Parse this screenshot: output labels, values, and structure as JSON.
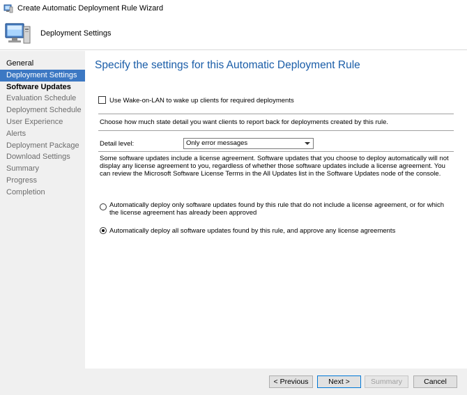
{
  "window": {
    "title": "Create Automatic Deployment Rule Wizard"
  },
  "header": {
    "page_name": "Deployment Settings"
  },
  "sidebar": {
    "items": [
      {
        "label": "General",
        "state": "done"
      },
      {
        "label": "Deployment Settings",
        "state": "active"
      },
      {
        "label": "Software Updates",
        "state": "current"
      },
      {
        "label": "Evaluation Schedule",
        "state": "pending"
      },
      {
        "label": "Deployment Schedule",
        "state": "pending"
      },
      {
        "label": "User Experience",
        "state": "pending"
      },
      {
        "label": "Alerts",
        "state": "pending"
      },
      {
        "label": "Deployment Package",
        "state": "pending"
      },
      {
        "label": "Download Settings",
        "state": "pending"
      },
      {
        "label": "Summary",
        "state": "pending"
      },
      {
        "label": "Progress",
        "state": "pending"
      },
      {
        "label": "Completion",
        "state": "pending"
      }
    ]
  },
  "main": {
    "heading": "Specify the settings for this Automatic Deployment Rule",
    "wol_label": "Use Wake-on-LAN to wake up clients for required deployments",
    "wol_checked": false,
    "state_detail_text": "Choose how much state detail you want clients to report back for deployments created by this rule.",
    "detail_level_label": "Detail level:",
    "detail_level_value": "Only error messages",
    "license_text": "Some software updates include a license agreement. Software updates that you choose to deploy automatically will not display any license agreement to you, regardless of whether those software updates include a license agreement. You can review the Microsoft Software License Terms in the All Updates list in the Software Updates node of the console.",
    "radio_option_1": "Automatically deploy only software updates found by this rule that do not include a license agreement, or for which the license agreement has already been approved",
    "radio_option_2": "Automatically deploy all software updates found by this rule, and approve any license agreements",
    "selected_radio": 2
  },
  "footer": {
    "previous_label": "< Previous",
    "next_label": "Next >",
    "summary_label": "Summary",
    "cancel_label": "Cancel"
  },
  "colors": {
    "accent": "#3c78c3",
    "heading": "#1a5da8",
    "sidebar_bg": "#f0f0f0"
  }
}
